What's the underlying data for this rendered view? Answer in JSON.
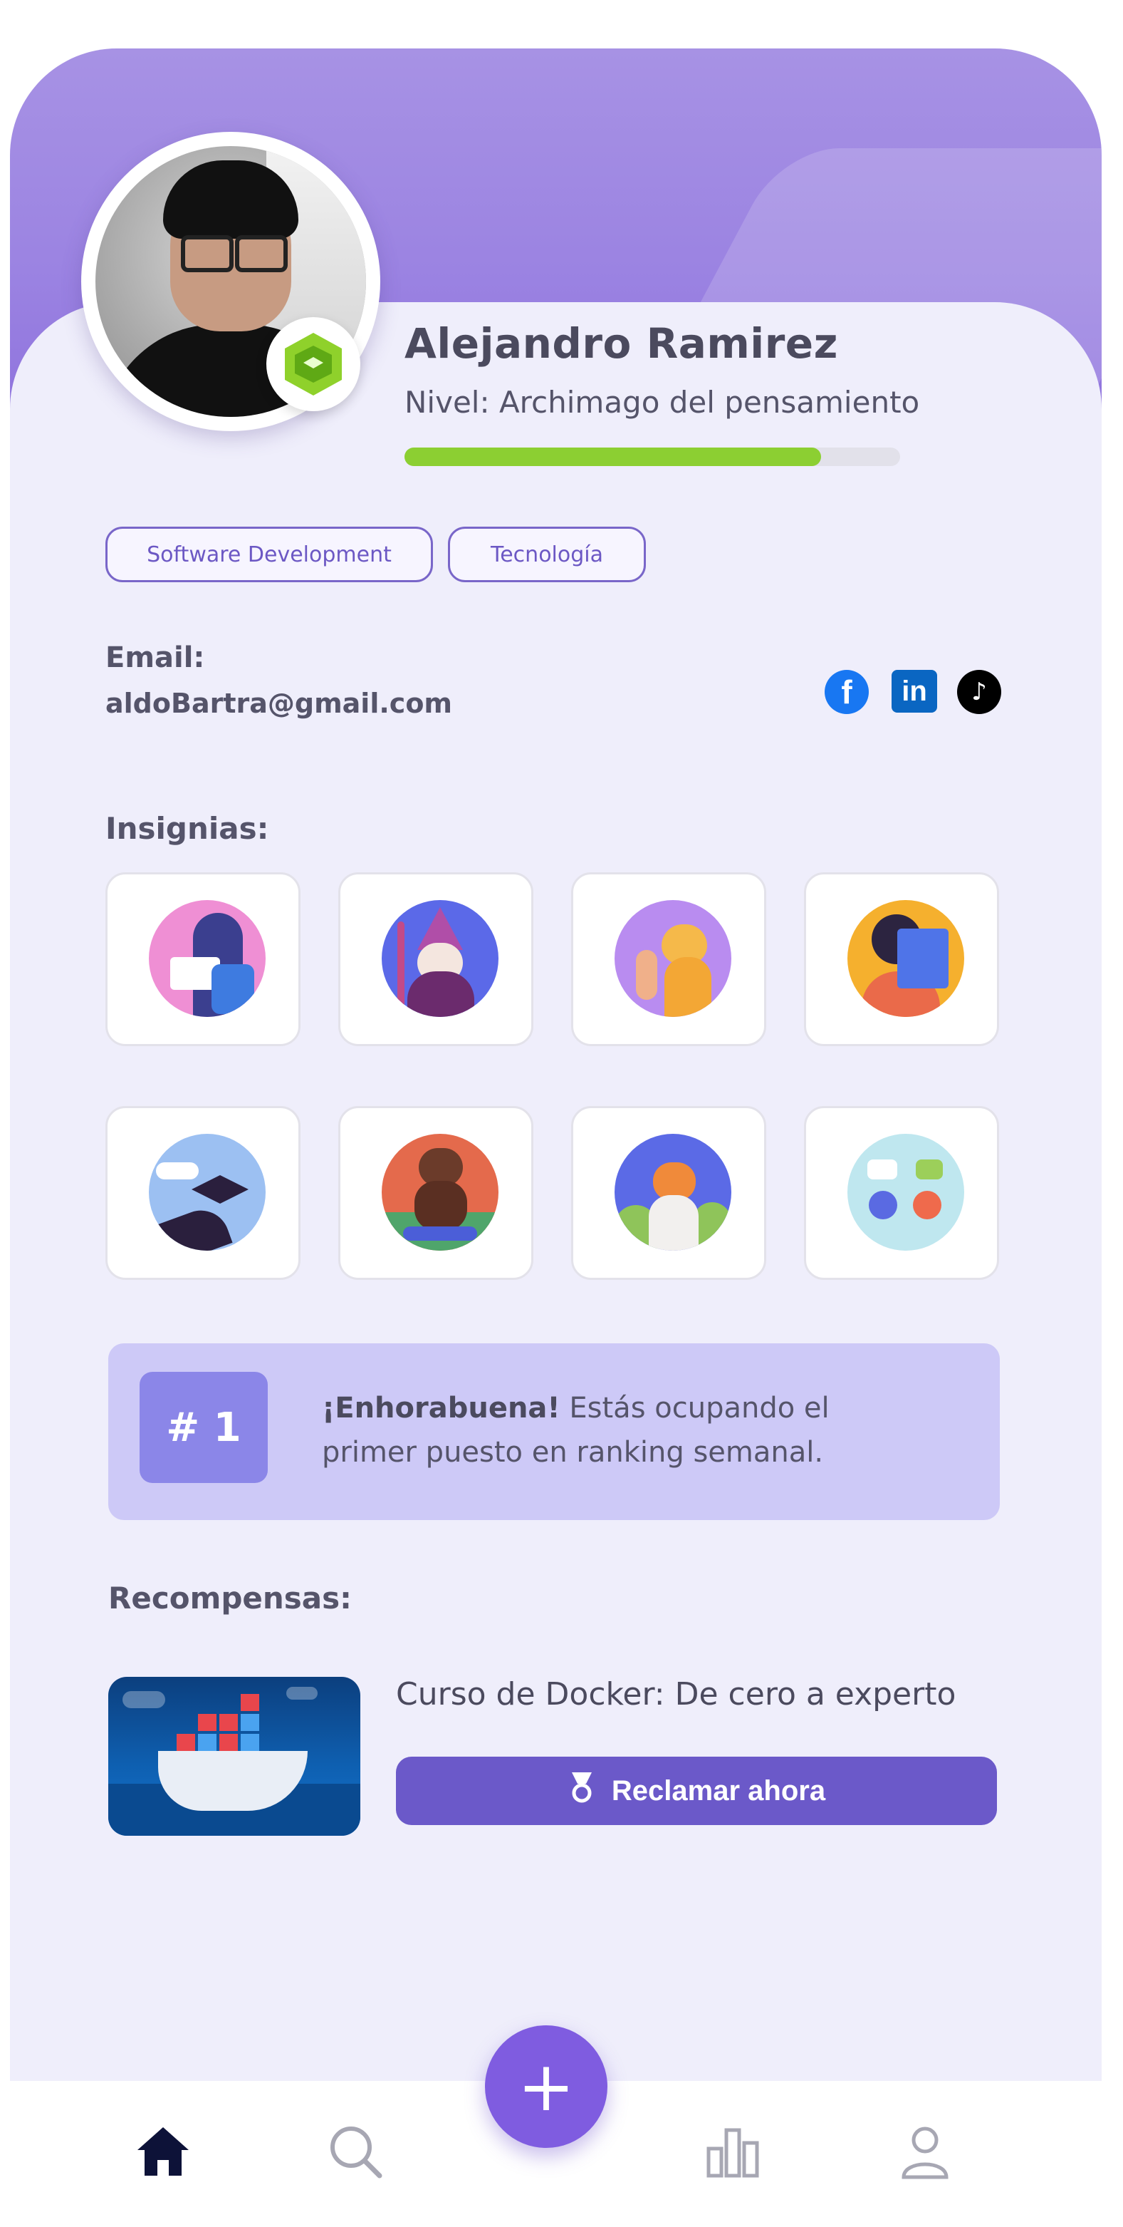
{
  "profile": {
    "name": "Alejandro Ramirez",
    "level_text": "Nivel: Archimago del pensamiento",
    "level_progress": 0.84,
    "level_badge_icon": "graduation-cap-hexagon-icon",
    "avatar_alt": "profile-photo"
  },
  "tags": [
    "Software Development",
    "Tecnología"
  ],
  "contact": {
    "email_label": "Email:",
    "email": "aldoBartra@gmail.com",
    "social": [
      {
        "name": "facebook",
        "glyph": "f",
        "color": "#1877f2"
      },
      {
        "name": "linkedin",
        "glyph": "in",
        "color": "#0a66c2"
      },
      {
        "name": "tiktok",
        "glyph": "♪",
        "color": "#000000"
      }
    ]
  },
  "insignias": {
    "title": "Insignias:",
    "badges": [
      {
        "name": "reading-wizard-badge",
        "bg": "#ef8fd4"
      },
      {
        "name": "wizard-staff-badge",
        "bg": "#5b69e8"
      },
      {
        "name": "cat-badge",
        "bg": "#b98cf0"
      },
      {
        "name": "reading-girl-badge",
        "bg": "#f5b02e"
      },
      {
        "name": "graduation-badge",
        "bg": "#9cc0f2"
      },
      {
        "name": "dog-badge",
        "bg": "#e46a4c"
      },
      {
        "name": "fox-badge",
        "bg": "#5b6ae6"
      },
      {
        "name": "community-badge",
        "bg": "#bfe7ef"
      }
    ]
  },
  "ranking": {
    "position": "# 1",
    "headline": "¡Enhorabuena!",
    "message": " Estás ocupando el primer puesto en ranking semanal."
  },
  "rewards": {
    "title": "Recompensas:",
    "items": [
      {
        "title": "Curso de  Docker: De cero a experto",
        "button_label": "Reclamar ahora"
      }
    ]
  },
  "nav": {
    "items": [
      "home-icon",
      "search-icon",
      "add-icon",
      "stats-icon",
      "user-icon"
    ],
    "fab_label": "+"
  },
  "colors": {
    "accent": "#6b59c9",
    "header": "#9b83e2",
    "progress": "#8ccf32",
    "rank_box": "#8b86e8"
  }
}
